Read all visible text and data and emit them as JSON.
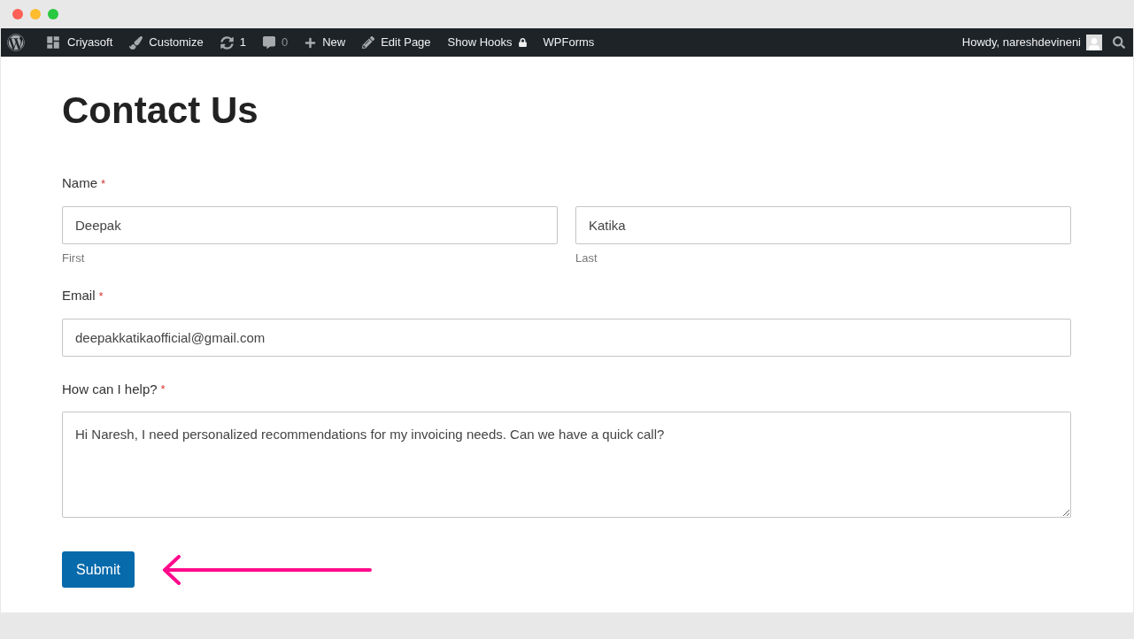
{
  "admin_bar": {
    "items": [
      {
        "kind": "logo"
      },
      {
        "kind": "dashboard",
        "label": "Criyasoft"
      },
      {
        "kind": "brush",
        "label": "Customize"
      },
      {
        "kind": "updates",
        "label": "1"
      },
      {
        "kind": "comments",
        "label": "0"
      },
      {
        "kind": "plus",
        "label": "New"
      },
      {
        "kind": "pencil",
        "label": "Edit Page"
      },
      {
        "kind": "lock",
        "label": "Show Hooks"
      },
      {
        "kind": "text",
        "label": "WPForms"
      }
    ],
    "greeting": "Howdy, nareshdevineni"
  },
  "page_title": "Contact Us",
  "form": {
    "fields": [
      {
        "kind": "name",
        "label": "Name",
        "required_mark": "*",
        "parts": [
          {
            "value": "Deepak",
            "sublabel": "First"
          },
          {
            "value": "Katika",
            "sublabel": "Last"
          }
        ]
      },
      {
        "kind": "input",
        "label": "Email",
        "required_mark": "*",
        "value": "deepakkatikaofficial@gmail.com"
      },
      {
        "kind": "textarea",
        "label": "How can I help?",
        "required_mark": "*",
        "value": "Hi Naresh, I need personalized recommendations for my invoicing needs. Can we have a quick call?"
      }
    ],
    "submit": "Submit"
  }
}
